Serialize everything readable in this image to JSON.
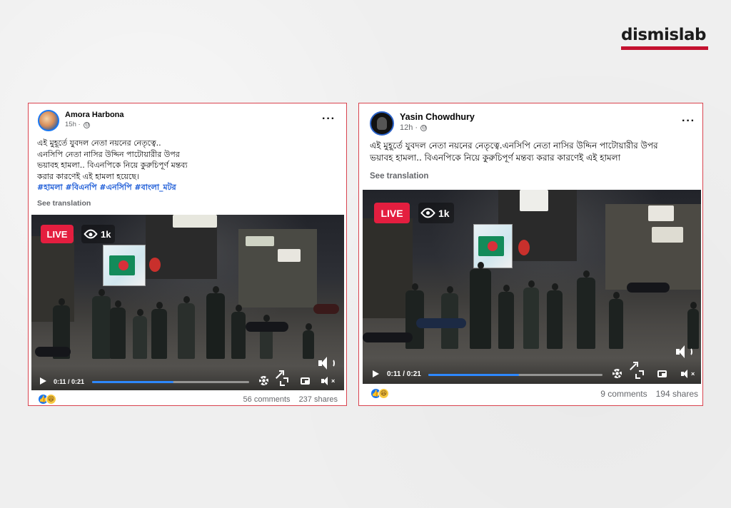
{
  "brand": {
    "logo_text": "dismislab",
    "accent_color": "#c4122f"
  },
  "posts": [
    {
      "author": "Amora Harbona",
      "time": "15h ·",
      "text_lines": [
        "এই মুহূর্তে যুবদল নেতা নয়নের নেতৃত্বে..",
        "এনসিপি নেতা নাসির উদ্দিন পাটোয়ারীর উপর",
        "ভয়াবহ হামলা.. বিএনপিকে নিয়ে কুরুচিপূর্ণ মন্তব্য",
        "করার কারণেই এই হামলা হয়েছে।"
      ],
      "hashtags": "#হামলা #বিএনপি #এনসিপি #বাংলা_মটর",
      "see_translation": "See translation",
      "live_label": "LIVE",
      "viewers": "1k",
      "timecode": "0:11 / 0:21",
      "progress": 0.52,
      "comments": "56 comments",
      "shares": "237 shares",
      "reaction_like": "👍",
      "reaction_haha": "😆"
    },
    {
      "author": "Yasin Chowdhury",
      "time": "12h ·",
      "text_lines": [
        "এই মুহূর্তে যুবদল নেতা নয়নের নেতৃত্বে.এনসিপি নেতা নাসির উদ্দিন পাটোয়ারীর উপর",
        "ভয়াবহ হামলা.. বিএনপিকে নিয়ে কুরুচিপূর্ণ মন্তব্য করার কারণেই এই হামলা"
      ],
      "see_translation": "See translation",
      "live_label": "LIVE",
      "viewers": "1k",
      "timecode": "0:11 / 0:21",
      "progress": 0.52,
      "comments": "9 comments",
      "shares": "194 shares",
      "reaction_like": "👍",
      "reaction_haha": "😆"
    }
  ],
  "icons": [
    "more-options-icon",
    "globe-icon",
    "eye-icon",
    "play-icon",
    "gear-icon",
    "expand-icon",
    "pip-icon",
    "mute-icon",
    "volume-icon"
  ]
}
